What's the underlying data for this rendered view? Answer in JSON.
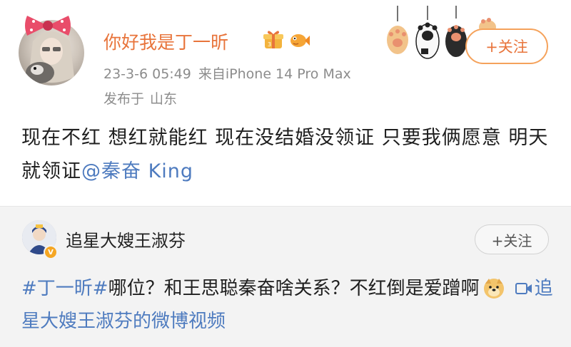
{
  "post": {
    "author": "你好我是丁一昕",
    "time": "23-3-6 05:49",
    "source": "来自iPhone 14 Pro Max",
    "location_prefix": "发布于",
    "location": "山东",
    "follow_label": "+关注",
    "text_main": "现在不红 想红就能红 现在没结婚没领证 只要我俩愿意 明天就领证",
    "mention": "@秦奋 King"
  },
  "repost": {
    "author": "追星大嫂王淑芬",
    "follow_label": "+关注",
    "hashtag": "#丁一昕#",
    "text": "哪位？和王思聪秦奋啥关系？不红倒是爱蹭啊",
    "video_link": "追星大嫂王淑芬的微博视频"
  },
  "icons": {
    "bow": "bow-icon",
    "badges": [
      "vip-gift-icon",
      "fish-icon"
    ],
    "paws": "cat-paws-icon",
    "doge": "doge-emoji-icon",
    "video": "video-icon",
    "verified": "verified-v-icon"
  },
  "colors": {
    "username": "#e8743b",
    "link": "#4e7bbf",
    "meta": "#8c8c8c",
    "follow_border": "#f5a25b"
  }
}
